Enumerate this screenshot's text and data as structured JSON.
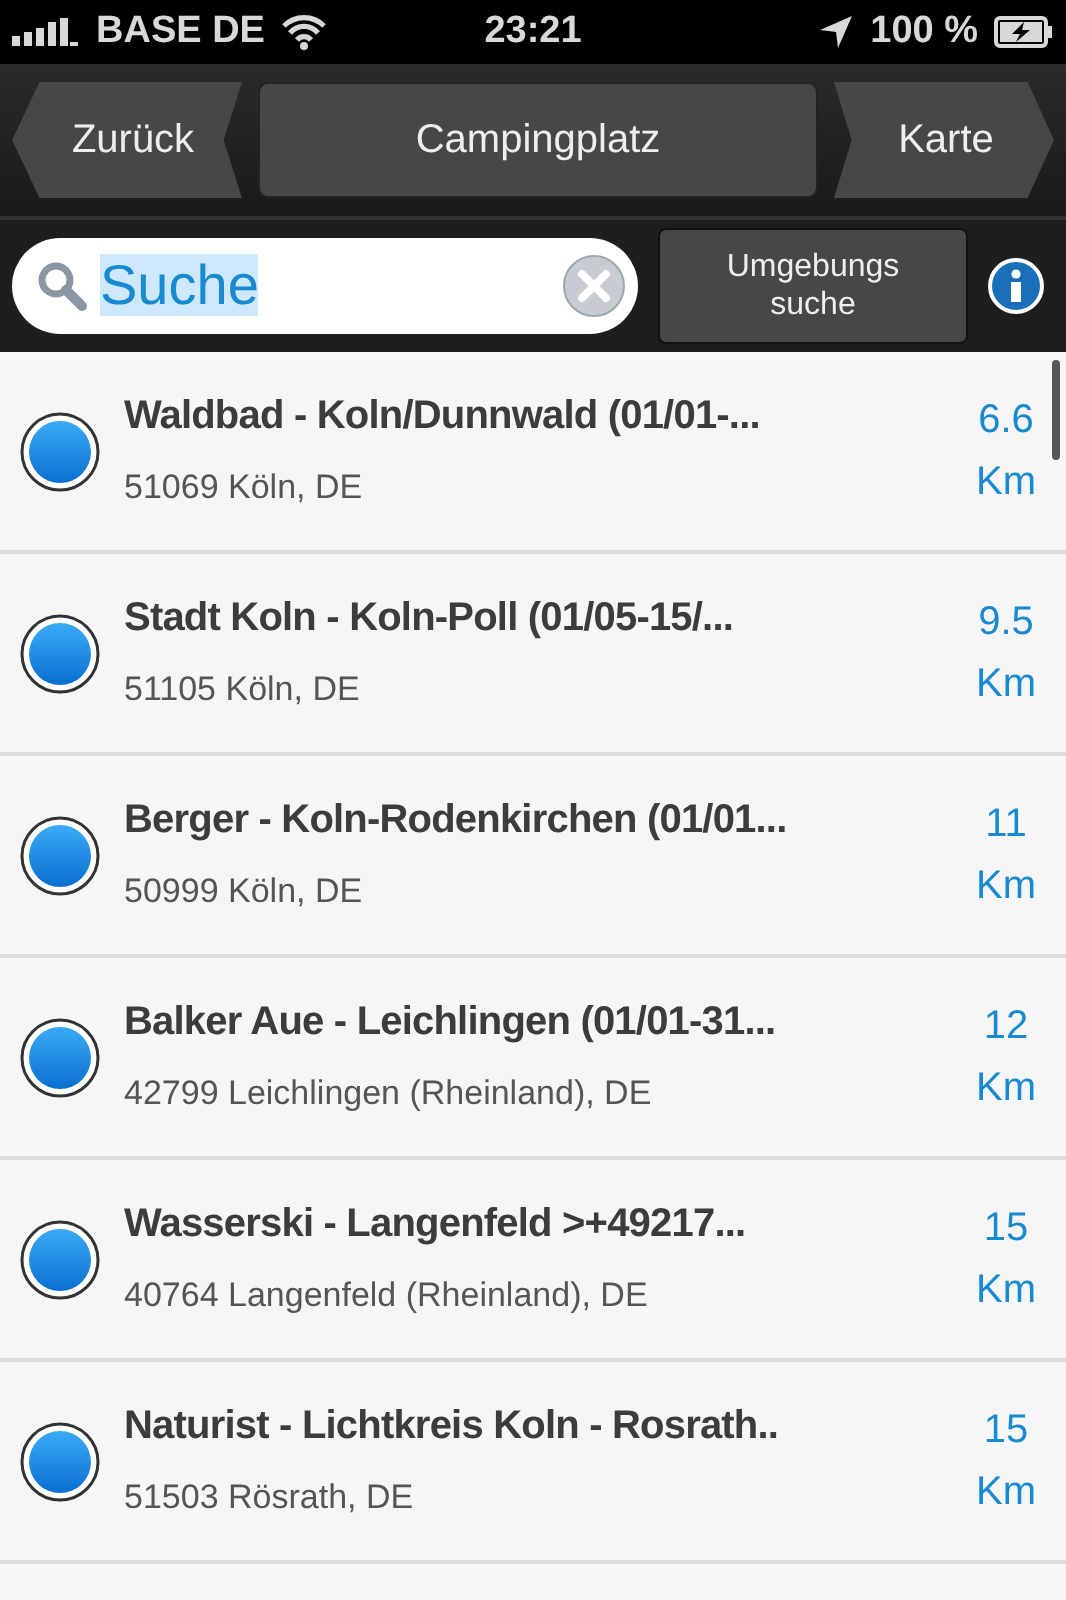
{
  "status_bar": {
    "carrier": "BASE DE",
    "time": "23:21",
    "battery": "100 %"
  },
  "nav_bar": {
    "back": "Zurück",
    "title": "Campingplatz",
    "forward": "Karte"
  },
  "search": {
    "value": "Suche",
    "nearby_button": "Umgebungs suche"
  },
  "results": [
    {
      "name": "Waldbad - Koln/Dunnwald (01/01-...",
      "address": "51069 Köln, DE",
      "distance": "6.6",
      "unit": "Km"
    },
    {
      "name": "Stadt Koln - Koln-Poll  (01/05-15/...",
      "address": "51105 Köln, DE",
      "distance": "9.5",
      "unit": "Km"
    },
    {
      "name": "Berger - Koln-Rodenkirchen (01/01...",
      "address": "50999 Köln, DE",
      "distance": "11",
      "unit": "Km"
    },
    {
      "name": "Balker Aue - Leichlingen (01/01-31...",
      "address": "42799 Leichlingen (Rheinland), DE",
      "distance": "12",
      "unit": "Km"
    },
    {
      "name": "Wasserski - Langenfeld >+49217...",
      "address": "40764 Langenfeld (Rheinland), DE",
      "distance": "15",
      "unit": "Km"
    },
    {
      "name": "Naturist - Lichtkreis Koln - Rosrath..",
      "address": "51503 Rösrath, DE",
      "distance": "15",
      "unit": "Km"
    }
  ]
}
